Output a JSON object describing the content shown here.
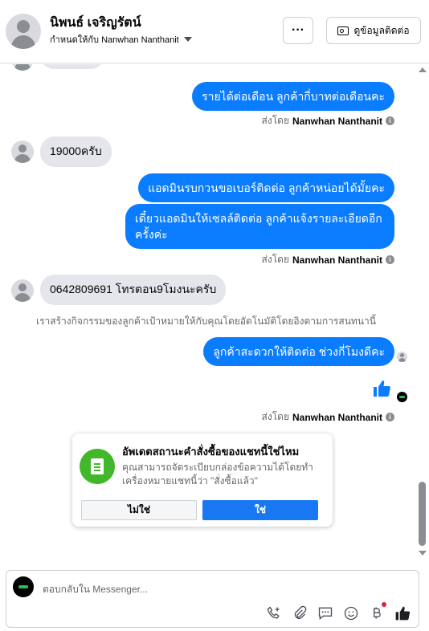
{
  "header": {
    "name": "นิพนธ์ เจริญรัตน์",
    "assigned_label": "กำหนดให้กับ Nanwhan Nanthanit",
    "more_label": "···",
    "contact_label": "ดูข้อมูลติดต่อ"
  },
  "messages": [
    {
      "dir": "out",
      "text": "รายได้ต่อเดือน ลูกค้ากี่บาทต่อเดือนคะ"
    },
    {
      "dir": "in",
      "text": "19000ครับ"
    },
    {
      "dir": "out",
      "text": "แอดมินรบกวนขอเบอร์ติดต่อ ลูกค้าหน่อยได้มั้ยคะ"
    },
    {
      "dir": "out",
      "text": "เดี๋ยวแอดมินให้เซลล์ติดต่อ ลูกค้าแจ้งรายละเอียดอีกครั้งค่ะ"
    },
    {
      "dir": "in",
      "text": "0642809691 โทรตอน9โมงนะครับ"
    },
    {
      "dir": "out",
      "text": "ลูกค้าสะดวกให้ติดต่อ ช่วงกี่โมงดีคะ"
    }
  ],
  "sent_by": {
    "prefix": "ส่งโดย",
    "name": "Nanwhan Nanthanit"
  },
  "system_note": "เราสร้างกิจกรรมของลูกค้าเป้าหมายให้กับคุณโดยอัตโนมัติโดยอิงตามการสนทนานี้",
  "card": {
    "title": "อัพเดตสถานะคำสั่งซื้อของแชทนี้ใช่ไหม",
    "description": "คุณสามารถจัดระเบียบกล่องข้อความได้โดยทำเครื่องหมายแชทนี้ว่า \"สั่งซื้อแล้ว\"",
    "no_label": "ไม่ใช่",
    "yes_label": "ใช่"
  },
  "composer": {
    "placeholder": "ตอบกลับใน Messenger..."
  },
  "colors": {
    "accent": "#0a7cff",
    "button_blue": "#1877f2",
    "green": "#42b72a"
  },
  "icons": {
    "tools": [
      "add-call-icon",
      "attachment-icon",
      "saved-reply-icon",
      "emoji-icon",
      "baht-icon",
      "like-icon"
    ]
  }
}
